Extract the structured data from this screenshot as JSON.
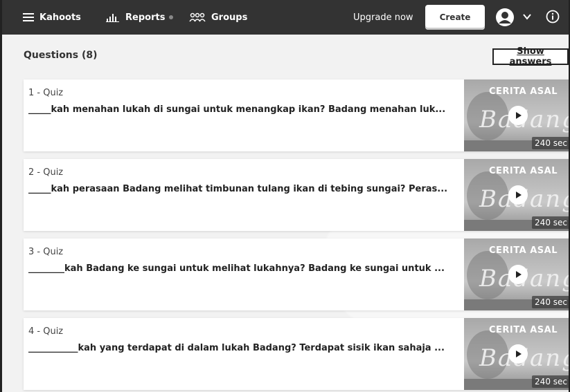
{
  "nav": {
    "kahoots_label": "Kahoots",
    "reports_label": "Reports",
    "groups_label": "Groups",
    "upgrade_label": "Upgrade now",
    "create_label": "Create"
  },
  "questions_heading": "Questions (8)",
  "show_answers_label": "Show answers",
  "thumbnail": {
    "title": "CERITA ASAL",
    "script": "Badang"
  },
  "questions": [
    {
      "number": "1 - Quiz",
      "text": "_____kah menahan lukah di sungai untuk menangkap ikan? Badang menahan luk...",
      "duration": "240 sec"
    },
    {
      "number": "2 - Quiz",
      "text": "_____kah perasaan Badang melihat timbunan tulang ikan di tebing sungai? Peras...",
      "duration": "240 sec"
    },
    {
      "number": "3 - Quiz",
      "text": "________kah Badang ke sungai untuk melihat lukahnya? Badang ke sungai untuk ...",
      "duration": "240 sec"
    },
    {
      "number": "4 - Quiz",
      "text": "___________kah yang terdapat di dalam lukah Badang? Terdapat sisik ikan sahaja ...",
      "duration": "240 sec"
    }
  ],
  "colors": {
    "topbar": "#333333",
    "page_bg": "#f2f2f2",
    "card_bg": "#ffffff"
  }
}
